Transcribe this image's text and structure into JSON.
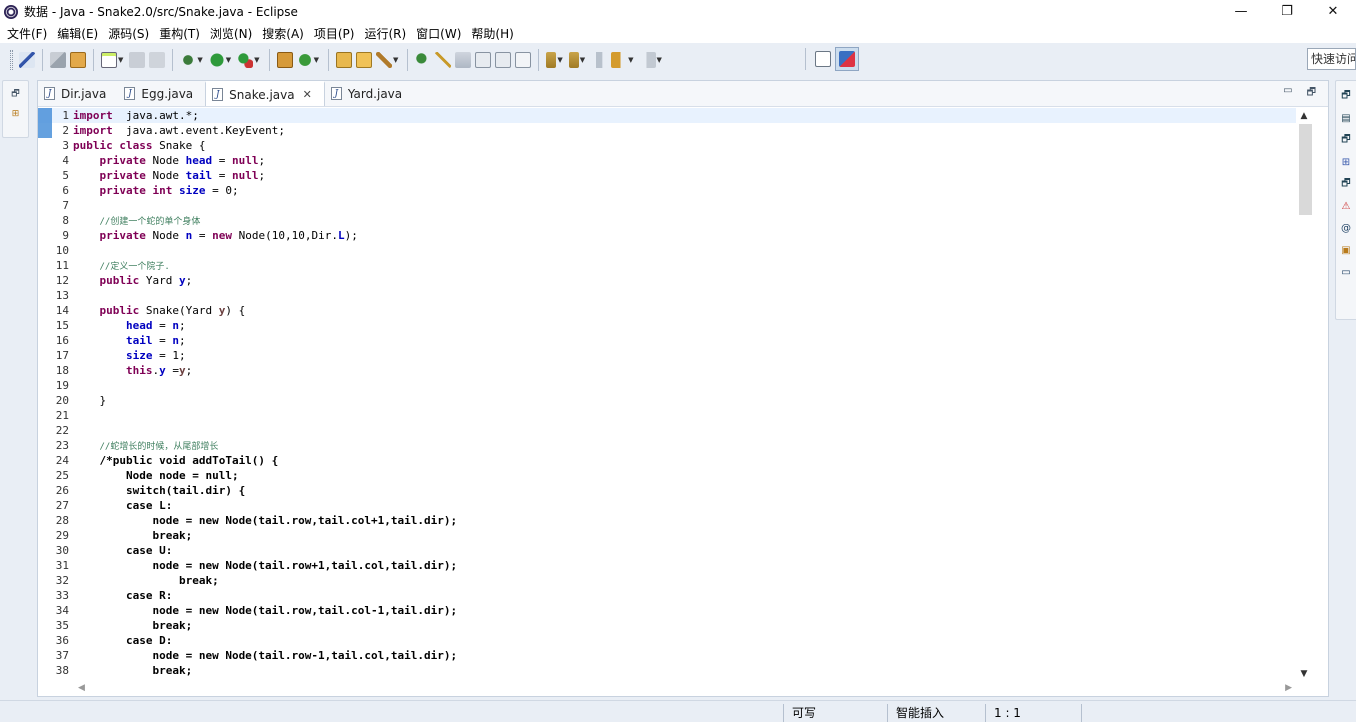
{
  "window": {
    "title": "数据 - Java - Snake2.0/src/Snake.java - Eclipse",
    "minimize": "—",
    "restore": "❐",
    "close": "✕"
  },
  "menu": [
    "文件(F)",
    "编辑(E)",
    "源码(S)",
    "重构(T)",
    "浏览(N)",
    "搜索(A)",
    "项目(P)",
    "运行(R)",
    "窗口(W)",
    "帮助(H)"
  ],
  "toolbar": {
    "quick_access_placeholder": "快速访问"
  },
  "tabs": [
    {
      "label": "Dir.java",
      "active": false
    },
    {
      "label": "Egg.java",
      "active": false
    },
    {
      "label": "Snake.java",
      "active": true
    },
    {
      "label": "Yard.java",
      "active": false
    }
  ],
  "editor": {
    "tab_close": "✕",
    "minimize": "▭",
    "maximize": "🗗",
    "lines": [
      {
        "n": "1",
        "tokens": [
          [
            "kw",
            "import"
          ],
          [
            "",
            "  java.awt.*;"
          ]
        ]
      },
      {
        "n": "2",
        "tokens": [
          [
            "kw",
            "import"
          ],
          [
            "",
            "  java.awt.event.KeyEvent;"
          ]
        ]
      },
      {
        "n": "3",
        "tokens": [
          [
            "kw",
            "public class"
          ],
          [
            "",
            " Snake {"
          ]
        ]
      },
      {
        "n": "4",
        "tokens": [
          [
            "",
            "    "
          ],
          [
            "kw",
            "private"
          ],
          [
            "",
            " Node "
          ],
          [
            "fld",
            "head"
          ],
          [
            "",
            " = "
          ],
          [
            "kw",
            "null"
          ],
          [
            "",
            ";"
          ]
        ]
      },
      {
        "n": "5",
        "tokens": [
          [
            "",
            "    "
          ],
          [
            "kw",
            "private"
          ],
          [
            "",
            " Node "
          ],
          [
            "fld",
            "tail"
          ],
          [
            "",
            " = "
          ],
          [
            "kw",
            "null"
          ],
          [
            "",
            ";"
          ]
        ]
      },
      {
        "n": "6",
        "tokens": [
          [
            "",
            "    "
          ],
          [
            "kw",
            "private int"
          ],
          [
            "",
            " "
          ],
          [
            "fld",
            "size"
          ],
          [
            "",
            " = 0;"
          ]
        ]
      },
      {
        "n": "7",
        "tokens": []
      },
      {
        "n": "8",
        "tokens": [
          [
            "",
            "    "
          ],
          [
            "cm",
            "//创建一个蛇的单个身体"
          ]
        ]
      },
      {
        "n": "9",
        "tokens": [
          [
            "",
            "    "
          ],
          [
            "kw",
            "private"
          ],
          [
            "",
            " Node "
          ],
          [
            "fld",
            "n"
          ],
          [
            "",
            " = "
          ],
          [
            "kw",
            "new"
          ],
          [
            "",
            " Node(10,10,Dir."
          ],
          [
            "fld",
            "L"
          ],
          [
            "",
            ");"
          ]
        ]
      },
      {
        "n": "10",
        "tokens": []
      },
      {
        "n": "11",
        "tokens": [
          [
            "",
            "    "
          ],
          [
            "cm",
            "//定义一个院子."
          ]
        ]
      },
      {
        "n": "12",
        "tokens": [
          [
            "",
            "    "
          ],
          [
            "kw",
            "public"
          ],
          [
            "",
            " Yard "
          ],
          [
            "fld",
            "y"
          ],
          [
            "",
            ";"
          ]
        ]
      },
      {
        "n": "13",
        "tokens": []
      },
      {
        "n": "14",
        "tokens": [
          [
            "",
            "    "
          ],
          [
            "kw",
            "public"
          ],
          [
            "",
            " Snake(Yard "
          ],
          [
            "prm",
            "y"
          ],
          [
            "",
            ") {"
          ]
        ]
      },
      {
        "n": "15",
        "tokens": [
          [
            "",
            "        "
          ],
          [
            "fld",
            "head"
          ],
          [
            "",
            " = "
          ],
          [
            "fld",
            "n"
          ],
          [
            "",
            ";"
          ]
        ]
      },
      {
        "n": "16",
        "tokens": [
          [
            "",
            "        "
          ],
          [
            "fld",
            "tail"
          ],
          [
            "",
            " = "
          ],
          [
            "fld",
            "n"
          ],
          [
            "",
            ";"
          ]
        ]
      },
      {
        "n": "17",
        "tokens": [
          [
            "",
            "        "
          ],
          [
            "fld",
            "size"
          ],
          [
            "",
            " = 1;"
          ]
        ]
      },
      {
        "n": "18",
        "tokens": [
          [
            "",
            "        "
          ],
          [
            "kw",
            "this"
          ],
          [
            "",
            "."
          ],
          [
            "fld",
            "y"
          ],
          [
            "",
            " ="
          ],
          [
            "prm",
            "y"
          ],
          [
            "",
            ";"
          ]
        ]
      },
      {
        "n": "19",
        "tokens": []
      },
      {
        "n": "20",
        "tokens": [
          [
            "",
            "    }"
          ]
        ]
      },
      {
        "n": "21",
        "tokens": []
      },
      {
        "n": "22",
        "tokens": []
      },
      {
        "n": "23",
        "tokens": [
          [
            "",
            "    "
          ],
          [
            "cm",
            "//蛇增长的时候，从尾部增长"
          ]
        ]
      },
      {
        "n": "24",
        "tokens": [
          [
            "bold",
            "    /*public void addToTail() {"
          ]
        ]
      },
      {
        "n": "25",
        "tokens": [
          [
            "bold",
            "        Node node = null;"
          ]
        ]
      },
      {
        "n": "26",
        "tokens": [
          [
            "bold",
            "        switch(tail.dir) {"
          ]
        ]
      },
      {
        "n": "27",
        "tokens": [
          [
            "bold",
            "        case L:"
          ]
        ]
      },
      {
        "n": "28",
        "tokens": [
          [
            "bold",
            "            node = new Node(tail.row,tail.col+1,tail.dir);"
          ]
        ]
      },
      {
        "n": "29",
        "tokens": [
          [
            "bold",
            "            break;"
          ]
        ]
      },
      {
        "n": "30",
        "tokens": [
          [
            "bold",
            "        case U:"
          ]
        ]
      },
      {
        "n": "31",
        "tokens": [
          [
            "bold",
            "            node = new Node(tail.row+1,tail.col,tail.dir);"
          ]
        ]
      },
      {
        "n": "32",
        "tokens": [
          [
            "bold",
            "                break;"
          ]
        ]
      },
      {
        "n": "33",
        "tokens": [
          [
            "bold",
            "        case R:"
          ]
        ]
      },
      {
        "n": "34",
        "tokens": [
          [
            "bold",
            "            node = new Node(tail.row,tail.col-1,tail.dir);"
          ]
        ]
      },
      {
        "n": "35",
        "tokens": [
          [
            "bold",
            "            break;"
          ]
        ]
      },
      {
        "n": "36",
        "tokens": [
          [
            "bold",
            "        case D:"
          ]
        ]
      },
      {
        "n": "37",
        "tokens": [
          [
            "bold",
            "            node = new Node(tail.row-1,tail.col,tail.dir);"
          ]
        ]
      },
      {
        "n": "38",
        "tokens": [
          [
            "bold",
            "            break;"
          ]
        ]
      }
    ]
  },
  "status": {
    "writable": "可写",
    "insert_mode": "智能插入",
    "position": "1 : 1"
  },
  "colors": {
    "keyword": "#7f0055",
    "field": "#0000c0",
    "comment": "#3f7f5f",
    "current_line": "#e8f2fe"
  }
}
